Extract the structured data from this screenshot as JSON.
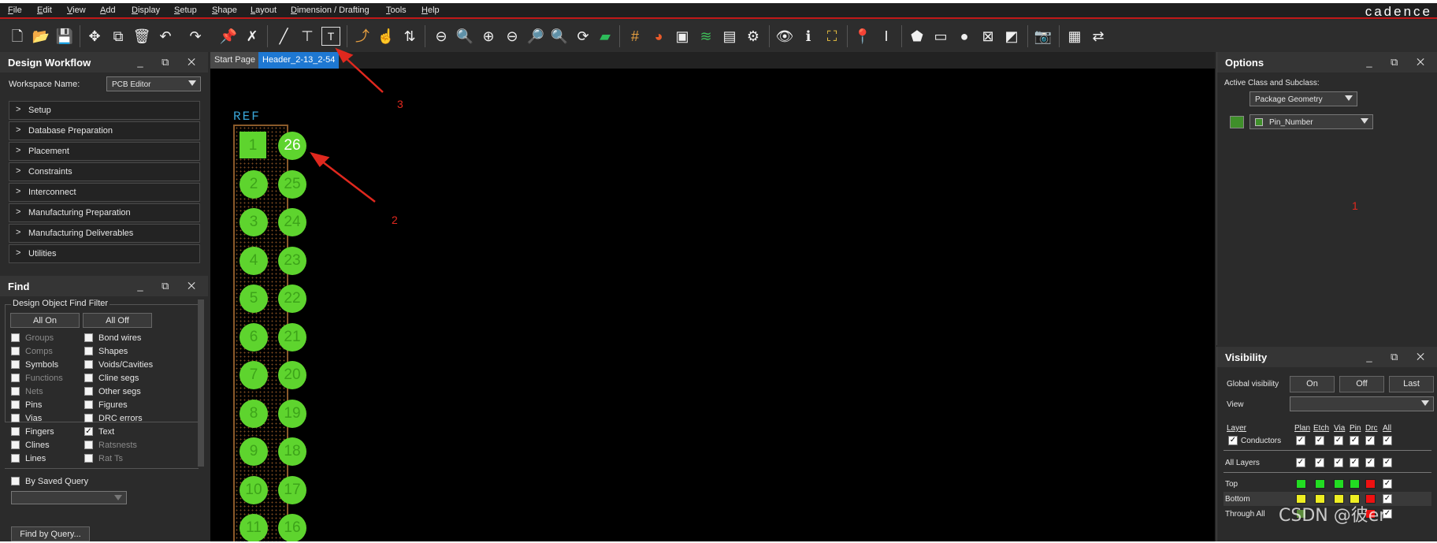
{
  "menu": [
    "File",
    "Edit",
    "View",
    "Add",
    "Display",
    "Setup",
    "Shape",
    "Layout",
    "Dimension / Drafting",
    "Tools",
    "Help"
  ],
  "brand": "cadence",
  "tabs": {
    "start": "Start Page",
    "active": "Header_2-13_2-54"
  },
  "workflow": {
    "title": "Design Workflow",
    "workspace_label": "Workspace Name:",
    "workspace_value": "PCB Editor",
    "items": [
      "Setup",
      "Database Preparation",
      "Placement",
      "Constraints",
      "Interconnect",
      "Manufacturing Preparation",
      "Manufacturing Deliverables",
      "Utilities"
    ]
  },
  "find": {
    "title": "Find",
    "group_label": "Design Object Find Filter",
    "all_on": "All On",
    "all_off": "All Off",
    "left": [
      "Groups",
      "Comps",
      "Symbols",
      "Functions",
      "Nets",
      "Pins",
      "Vias",
      "Fingers",
      "Clines",
      "Lines"
    ],
    "right": [
      "Bond wires",
      "Shapes",
      "Voids/Cavities",
      "Cline segs",
      "Other segs",
      "Figures",
      "DRC errors",
      "Text",
      "Ratsnests",
      "Rat Ts"
    ],
    "by_saved_query": "By Saved Query",
    "find_by_query": "Find by Query..."
  },
  "canvas": {
    "ref_label": "REF",
    "pins_left": [
      "1",
      "2",
      "3",
      "4",
      "5",
      "6",
      "7",
      "8",
      "9",
      "10",
      "11"
    ],
    "pins_right": [
      "26",
      "25",
      "24",
      "23",
      "22",
      "21",
      "20",
      "19",
      "18",
      "17",
      "16"
    ]
  },
  "annotations": [
    "1",
    "2",
    "3"
  ],
  "options": {
    "title": "Options",
    "active_label": "Active Class and Subclass:",
    "class_value": "Package Geometry",
    "subclass_value": "Pin_Number"
  },
  "visibility": {
    "title": "Visibility",
    "global_label": "Global visibility",
    "on": "On",
    "off": "Off",
    "last": "Last",
    "view_label": "View",
    "col_layer": "Layer",
    "cols": [
      "Plan",
      "Etch",
      "Via",
      "Pin",
      "Drc",
      "All"
    ],
    "rows": [
      "Conductors",
      "All Layers",
      "Top",
      "Bottom",
      "Through All"
    ]
  },
  "watermark": "CSDN @彼er",
  "colors": {
    "accent_red": "#c01818",
    "pin_green": "#5ed42e",
    "tab_blue": "#1e78d2",
    "annotation_red": "#e0281e"
  }
}
